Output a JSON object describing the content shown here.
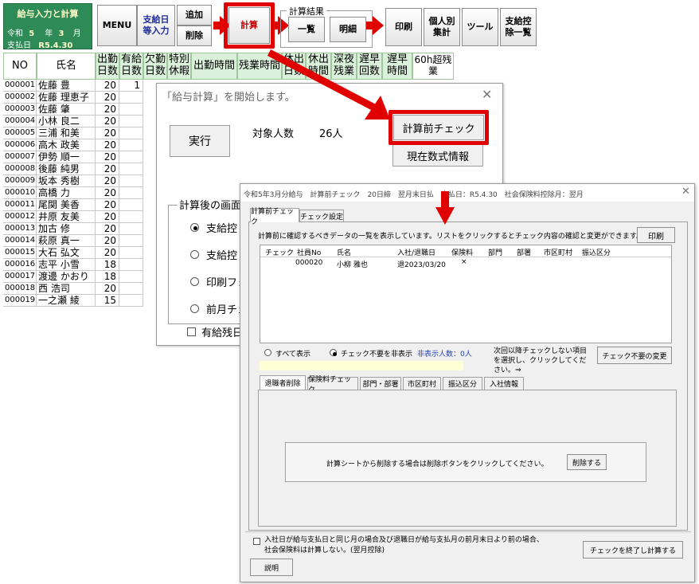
{
  "excel": {
    "title": "給与入力と計算",
    "era": "令和",
    "year": "5",
    "year_unit": "年",
    "month": "3",
    "month_unit": "月",
    "pay_date_label": "支払日",
    "pay_date": "R5.4.30",
    "toolbar": {
      "menu": "MENU",
      "paydate_input": "支給日\n等入力",
      "add": "追加",
      "delete": "削除",
      "calc": "計算",
      "calc_result_group": "計算結果",
      "list": "一覧",
      "detail": "明細",
      "print": "印刷",
      "per_person_total": "個人別\n集計",
      "tool": "ツール",
      "deduction_list": "支給控\n除一覧"
    },
    "columns": [
      "NO",
      "氏名",
      "出勤\n日数",
      "有給\n日数",
      "欠勤\n日数",
      "特別\n休暇",
      "出勤時間",
      "残業時間",
      "休出\n日数",
      "休出\n時間",
      "深夜\n残業",
      "遅早\n回数",
      "遅早\n時間",
      "60h超残\n業"
    ],
    "rows": [
      {
        "no": "000001",
        "name": "佐藤 豊",
        "days": "20",
        "paid": "1"
      },
      {
        "no": "000002",
        "name": "佐藤 理恵子",
        "days": "20",
        "paid": ""
      },
      {
        "no": "000003",
        "name": "佐藤 肇",
        "days": "20",
        "paid": ""
      },
      {
        "no": "000004",
        "name": "小林 良二",
        "days": "20",
        "paid": ""
      },
      {
        "no": "000005",
        "name": "三浦 和美",
        "days": "20",
        "paid": ""
      },
      {
        "no": "000006",
        "name": "高木 政美",
        "days": "20",
        "paid": ""
      },
      {
        "no": "000007",
        "name": "伊勢 順一",
        "days": "20",
        "paid": ""
      },
      {
        "no": "000008",
        "name": "後藤 純男",
        "days": "20",
        "paid": ""
      },
      {
        "no": "000009",
        "name": "坂本 秀樹",
        "days": "20",
        "paid": ""
      },
      {
        "no": "000010",
        "name": "高橋 力",
        "days": "20",
        "paid": ""
      },
      {
        "no": "000011",
        "name": "尾関 美香",
        "days": "20",
        "paid": ""
      },
      {
        "no": "000012",
        "name": "井原 友美",
        "days": "20",
        "paid": ""
      },
      {
        "no": "000013",
        "name": "加古 修",
        "days": "20",
        "paid": ""
      },
      {
        "no": "000014",
        "name": "萩原 真一",
        "days": "20",
        "paid": ""
      },
      {
        "no": "000015",
        "name": "大石 弘文",
        "days": "20",
        "paid": ""
      },
      {
        "no": "000016",
        "name": "志平 小雪",
        "days": "18",
        "paid": ""
      },
      {
        "no": "000017",
        "name": "渡邊 かおり",
        "days": "18",
        "paid": ""
      },
      {
        "no": "000018",
        "name": "西 浩司",
        "days": "20",
        "paid": ""
      },
      {
        "no": "000019",
        "name": "一之瀬 綾",
        "days": "15",
        "paid": ""
      }
    ]
  },
  "dialog1": {
    "title": "「給与計算」を開始します。",
    "execute": "実行",
    "target_label": "対象人数",
    "target_count": "26人",
    "precheck": "計算前チェック",
    "formula_info": "現在数式情報",
    "after_calc_group": "計算後の画面",
    "options": [
      "支給控",
      "支給控",
      "印刷フォ",
      "前月チェ"
    ],
    "paid_leave": "有給残日"
  },
  "dialog2": {
    "title": "令和5年3月分給与　計算前チェック　20日締　翌月末日払　支払日：R5.4.30　社会保険料控除月：翌月",
    "tabs": [
      "計算前チェック",
      "チェック設定"
    ],
    "description": "計算前に確認するべきデータの一覧を表示しています。リストをクリックするとチェック内容の確認と変更ができます。",
    "print": "印刷",
    "list_columns": [
      "チェック",
      "社員No",
      "氏名",
      "入社/退職日",
      "保険料",
      "部門",
      "部署",
      "市区町村",
      "振込区分"
    ],
    "list_rows": [
      {
        "emp_no": "000020",
        "name": "小柳 雅也",
        "date": "退2023/03/20",
        "insurance": "×"
      }
    ],
    "show_all": "すべて表示",
    "hide_unneeded": "チェック不要を非表示",
    "hidden_count": "非表示人数：0人",
    "hint": "次回以降チェックしない項目を選択し、クリックしてください。⇒",
    "change_unneeded": "チェック不要の変更",
    "sub_tabs": [
      "退職者削除",
      "保険料チェック",
      "部門・部署",
      "市区町村",
      "振込区分",
      "入社情報"
    ],
    "delete_msg": "計算シートから削除する場合は削除ボタンをクリックしてください。",
    "delete_button": "削除する",
    "footer_note_1": "入社日が給与支払日と同じ月の場合及び退職日が給与支払月の前月末日より前の場合、",
    "footer_note_2": "社会保険料は計算しない。(翌月控除)",
    "explain": "説明",
    "finish_calc": "チェックを終了し計算する"
  },
  "colors": {
    "accent_red": "#e00000",
    "title_green": "#2e8b57",
    "header_green": "#dbf0da",
    "hidden_count_blue": "#1f3fbf"
  }
}
